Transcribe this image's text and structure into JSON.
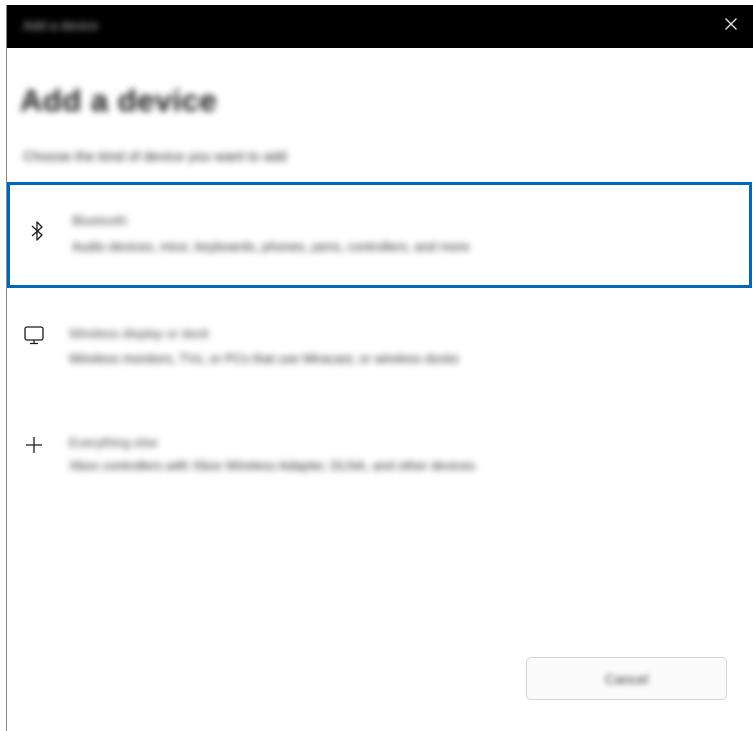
{
  "window": {
    "title": "Add a device"
  },
  "dialog": {
    "heading": "Add a device",
    "subtitle": "Choose the kind of device you want to add",
    "options": [
      {
        "icon": "bluetooth-icon",
        "title": "Bluetooth",
        "description": "Audio devices, mice, keyboards, phones, pens, controllers, and more",
        "selected": true
      },
      {
        "icon": "monitor-icon",
        "title": "Wireless display or dock",
        "description": "Wireless monitors, TVs, or PCs that use Miracast, or wireless docks",
        "selected": false
      },
      {
        "icon": "plus-icon",
        "title": "Everything else",
        "description": "Xbox controllers with Xbox Wireless Adapter, DLNA, and other devices",
        "selected": false
      }
    ],
    "cancel_label": "Cancel"
  },
  "colors": {
    "accent": "#0067b8",
    "titlebar": "#000000"
  }
}
